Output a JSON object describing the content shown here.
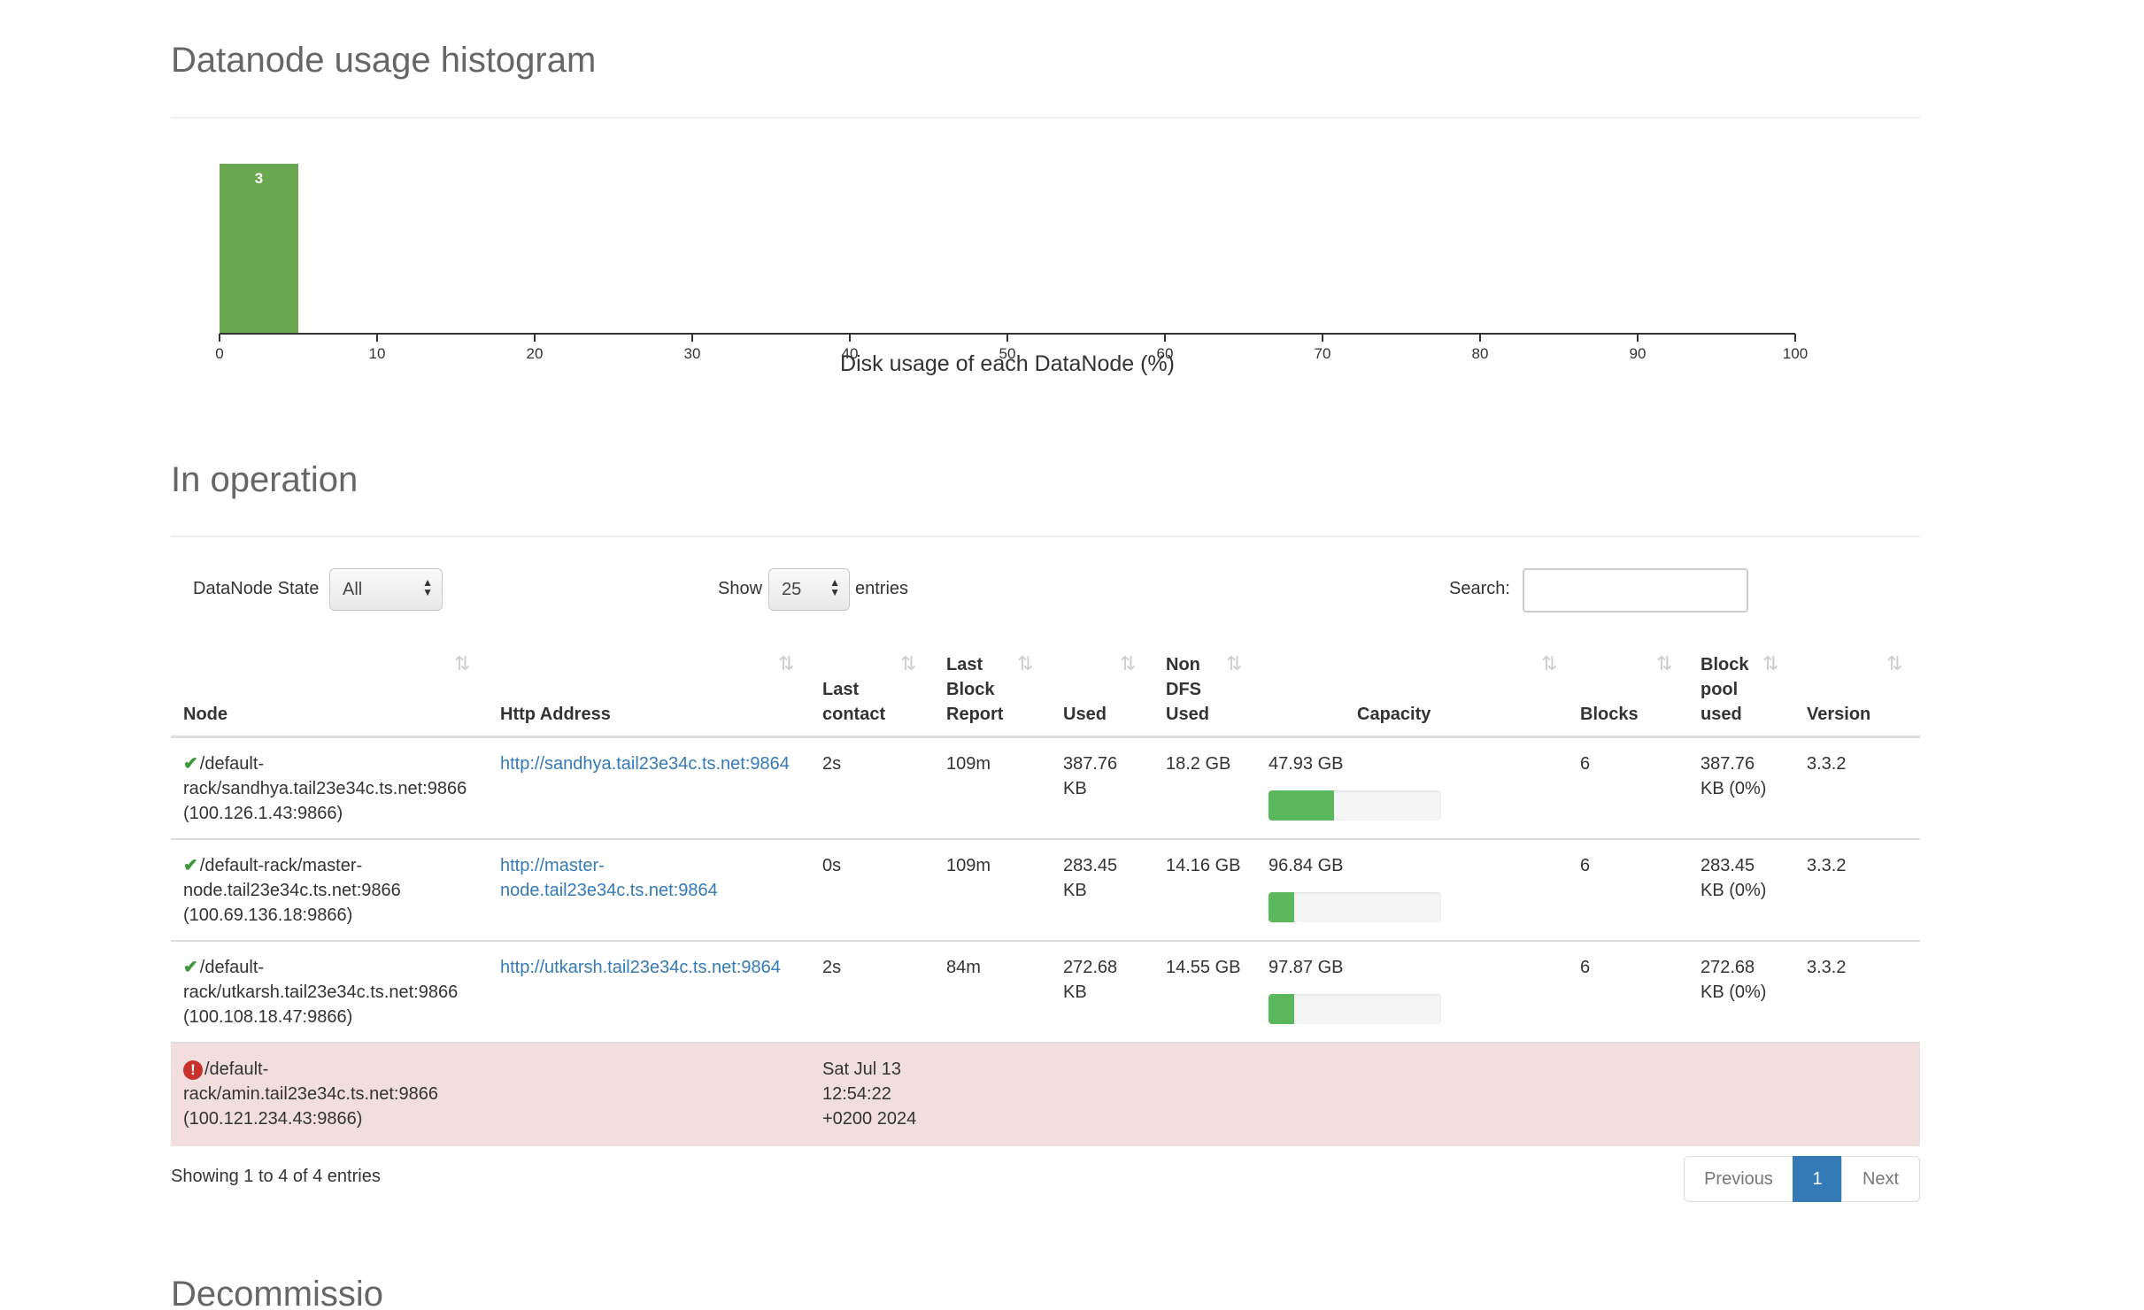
{
  "histogram": {
    "title": "Datanode usage histogram",
    "chart_data": {
      "type": "bar",
      "title": "",
      "xlabel": "Disk usage of each DataNode (%)",
      "ylabel": "",
      "xlim": [
        0,
        100
      ],
      "x_ticks": [
        0,
        10,
        20,
        30,
        40,
        50,
        60,
        70,
        80,
        90,
        100
      ],
      "bins": [
        {
          "x0": 0,
          "x1": 5,
          "count": 3
        }
      ],
      "bar_color": "#6aa84f"
    }
  },
  "operation": {
    "title": "In operation",
    "state_label": "DataNode State",
    "state_value": "All",
    "show_label": "Show",
    "show_value": "25",
    "entries_label": "entries",
    "search_label": "Search:",
    "columns": {
      "node": "Node",
      "http": "Http Address",
      "last_contact": "Last contact",
      "last_block": "Last Block Report",
      "used": "Used",
      "non_dfs": "Non DFS Used",
      "capacity": "Capacity",
      "blocks": "Blocks",
      "block_pool": "Block pool used",
      "version": "Version"
    },
    "rows": [
      {
        "status": "ok",
        "node": "/default-rack/sandhya.tail23e34c.ts.net:9866 (100.126.1.43:9866)",
        "http": "http://sandhya.tail23e34c.ts.net:9864",
        "last_contact": "2s",
        "last_block": "109m",
        "used": "387.76 KB",
        "non_dfs": "18.2 GB",
        "capacity": "47.93 GB",
        "capacity_used_pct": 38,
        "blocks": "6",
        "block_pool": "387.76 KB (0%)",
        "version": "3.3.2"
      },
      {
        "status": "ok",
        "node": "/default-rack/master-node.tail23e34c.ts.net:9866 (100.69.136.18:9866)",
        "http": "http://master-node.tail23e34c.ts.net:9864",
        "last_contact": "0s",
        "last_block": "109m",
        "used": "283.45 KB",
        "non_dfs": "14.16 GB",
        "capacity": "96.84 GB",
        "capacity_used_pct": 15,
        "blocks": "6",
        "block_pool": "283.45 KB (0%)",
        "version": "3.3.2"
      },
      {
        "status": "ok",
        "node": "/default-rack/utkarsh.tail23e34c.ts.net:9866 (100.108.18.47:9866)",
        "http": "http://utkarsh.tail23e34c.ts.net:9864",
        "last_contact": "2s",
        "last_block": "84m",
        "used": "272.68 KB",
        "non_dfs": "14.55 GB",
        "capacity": "97.87 GB",
        "capacity_used_pct": 15,
        "blocks": "6",
        "block_pool": "272.68 KB (0%)",
        "version": "3.3.2"
      },
      {
        "status": "dead",
        "node": "/default-rack/amin.tail23e34c.ts.net:9866 (100.121.234.43:9866)",
        "last_contact": "Sat Jul 13 12:54:22 +0200 2024"
      }
    ],
    "info": "Showing 1 to 4 of 4 entries",
    "pager": {
      "previous": "Previous",
      "current": "1",
      "next": "Next"
    }
  },
  "next_section_title": "Decommissioning"
}
